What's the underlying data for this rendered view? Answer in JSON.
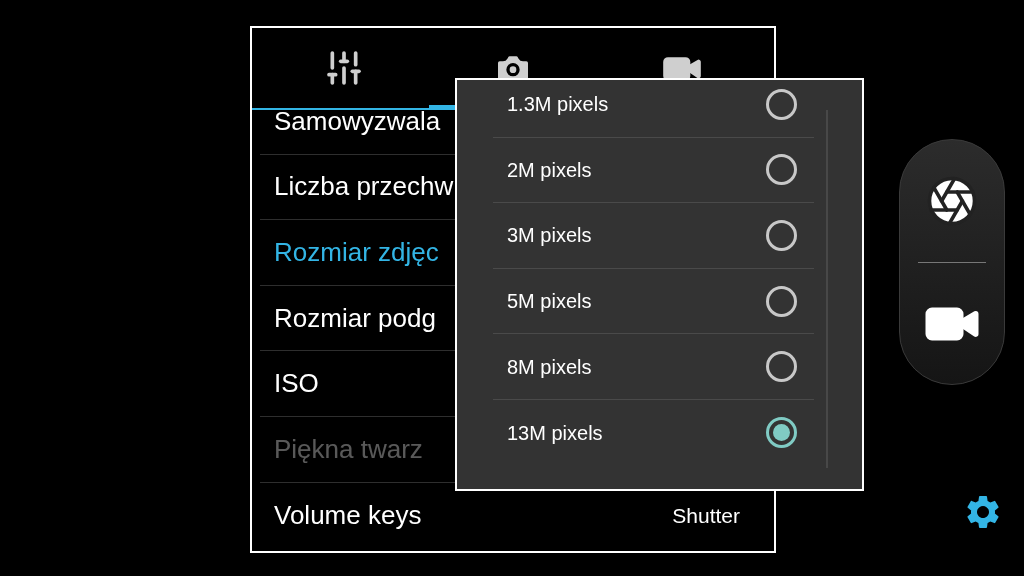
{
  "tabs": [
    {
      "kind": "settings",
      "selected": false
    },
    {
      "kind": "camera",
      "selected": true
    },
    {
      "kind": "video",
      "selected": false
    }
  ],
  "settings": [
    {
      "label": "Samowyzwala",
      "selected": false,
      "disabled": false
    },
    {
      "label": "Liczba przechw",
      "selected": false,
      "disabled": false
    },
    {
      "label": "Rozmiar zdjęc",
      "selected": true,
      "disabled": false
    },
    {
      "label": "Rozmiar podg",
      "selected": false,
      "disabled": false
    },
    {
      "label": "ISO",
      "selected": false,
      "disabled": false
    },
    {
      "label": "Piękna twarz",
      "selected": false,
      "disabled": true
    },
    {
      "label": "Volume keys",
      "value": "Shutter",
      "selected": false,
      "disabled": false
    }
  ],
  "size_options": [
    {
      "label": "1.3M pixels",
      "selected": false
    },
    {
      "label": "2M pixels",
      "selected": false
    },
    {
      "label": "3M pixels",
      "selected": false
    },
    {
      "label": "5M pixels",
      "selected": false
    },
    {
      "label": "8M pixels",
      "selected": false
    },
    {
      "label": "13M pixels",
      "selected": true
    }
  ]
}
